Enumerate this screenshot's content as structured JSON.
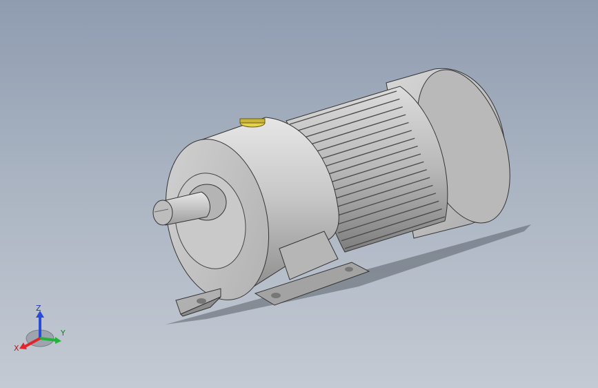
{
  "viewport": {
    "background_top": "#8f9cb0",
    "background_bottom": "#c4cad3"
  },
  "model": {
    "body_color": "#c4c4c4",
    "shadow_color": "#555a63",
    "fin_color": "#9a9a9a",
    "plug_color": "#e3d24a"
  },
  "triad": {
    "x_label": "X",
    "y_label": "Y",
    "z_label": "Z",
    "x_color": "#e0262b",
    "y_color": "#23b33a",
    "z_color": "#2a4ad8"
  }
}
